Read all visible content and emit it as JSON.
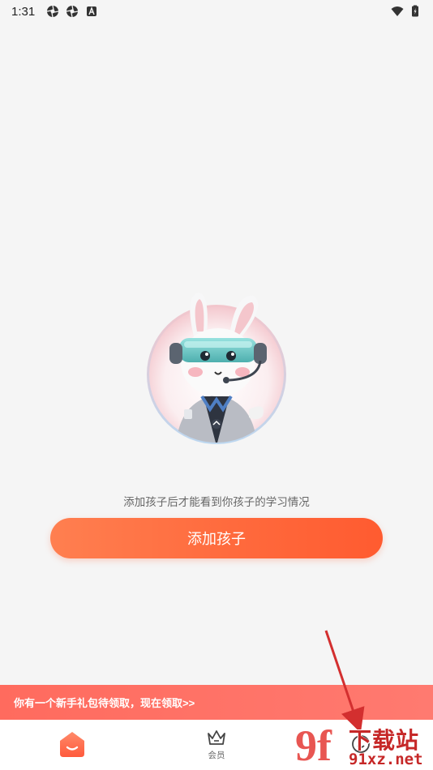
{
  "status_bar": {
    "time": "1:31",
    "left_icons": [
      "aperture-icon",
      "aperture-icon",
      "translate-a-icon"
    ],
    "right_icons": [
      "wifi-icon",
      "battery-charging-icon"
    ]
  },
  "main": {
    "hint": "添加孩子后才能看到你孩子的学习情况",
    "add_button": "添加孩子"
  },
  "promo": {
    "text": "你有一个新手礼包待领取，现在领取>>"
  },
  "tabbar": {
    "tabs": [
      {
        "label": "",
        "icon": "home-icon",
        "active": true
      },
      {
        "label": "会员",
        "icon": "crown-icon",
        "active": false
      },
      {
        "label": "",
        "icon": "profile-icon",
        "active": false
      }
    ]
  },
  "watermark": {
    "logo": "9f",
    "title": "下载站",
    "domain": "91xz.net"
  },
  "colors": {
    "accent": "#ff6a3d",
    "promo": "#ff6b5e",
    "arrow": "#d32f2f"
  }
}
